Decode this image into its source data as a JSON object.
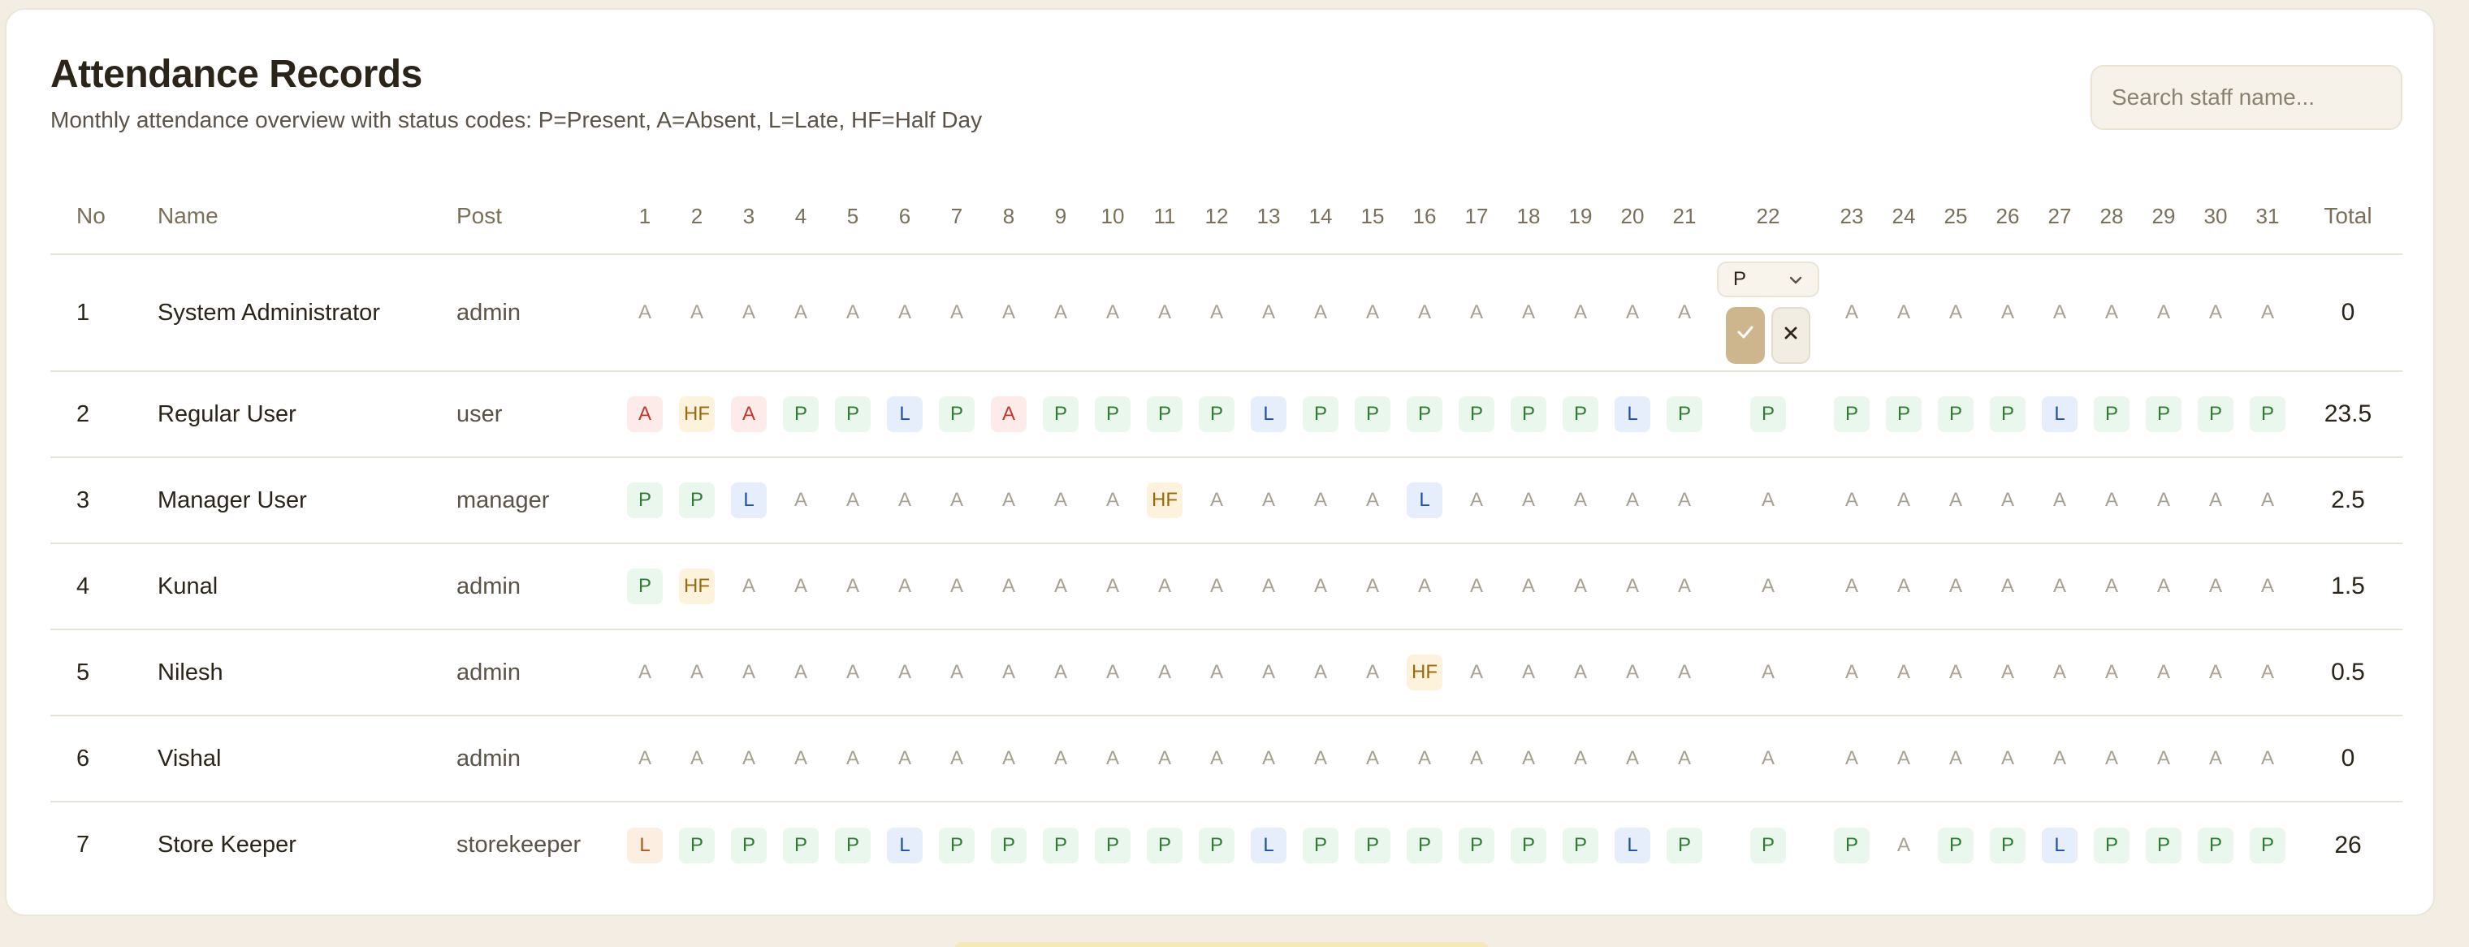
{
  "page": {
    "title": "Attendance Records",
    "subtitle": "Monthly attendance overview with status codes: P=Present, A=Absent, L=Late, HF=Half Day",
    "search_placeholder": "Search staff name..."
  },
  "table": {
    "headers": {
      "no": "No",
      "name": "Name",
      "post": "Post",
      "total": "Total"
    },
    "days": [
      "1",
      "2",
      "3",
      "4",
      "5",
      "6",
      "7",
      "8",
      "9",
      "10",
      "11",
      "12",
      "13",
      "14",
      "15",
      "16",
      "17",
      "18",
      "19",
      "20",
      "21",
      "22",
      "23",
      "24",
      "25",
      "26",
      "27",
      "28",
      "29",
      "30",
      "31"
    ],
    "rows": [
      {
        "no": "1",
        "name": "System Administrator",
        "post": "admin",
        "total": "0",
        "days": [
          "A",
          "A",
          "A",
          "A",
          "A",
          "A",
          "A",
          "A",
          "A",
          "A",
          "A",
          "A",
          "A",
          "A",
          "A",
          "A",
          "A",
          "A",
          "A",
          "A",
          "A",
          "",
          "A",
          "A",
          "A",
          "A",
          "A",
          "A",
          "A",
          "A",
          "A"
        ]
      },
      {
        "no": "2",
        "name": "Regular User",
        "post": "user",
        "total": "23.5",
        "days": [
          "A",
          "HF",
          "A",
          "P",
          "P",
          "L",
          "P",
          "A",
          "P",
          "P",
          "P",
          "P",
          "L",
          "P",
          "P",
          "P",
          "P",
          "P",
          "P",
          "L",
          "P",
          "P",
          "P",
          "P",
          "P",
          "P",
          "L",
          "P",
          "P",
          "P",
          "P"
        ]
      },
      {
        "no": "3",
        "name": "Manager User",
        "post": "manager",
        "total": "2.5",
        "days": [
          "P",
          "P",
          "L",
          "A",
          "A",
          "A",
          "A",
          "A",
          "A",
          "A",
          "HF",
          "A",
          "A",
          "A",
          "A",
          "L",
          "A",
          "A",
          "A",
          "A",
          "A",
          "A",
          "A",
          "A",
          "A",
          "A",
          "A",
          "A",
          "A",
          "A",
          "A"
        ]
      },
      {
        "no": "4",
        "name": "Kunal",
        "post": "admin",
        "total": "1.5",
        "days": [
          "P",
          "HF",
          "A",
          "A",
          "A",
          "A",
          "A",
          "A",
          "A",
          "A",
          "A",
          "A",
          "A",
          "A",
          "A",
          "A",
          "A",
          "A",
          "A",
          "A",
          "A",
          "A",
          "A",
          "A",
          "A",
          "A",
          "A",
          "A",
          "A",
          "A",
          "A"
        ]
      },
      {
        "no": "5",
        "name": "Nilesh",
        "post": "admin",
        "total": "0.5",
        "days": [
          "A",
          "A",
          "A",
          "A",
          "A",
          "A",
          "A",
          "A",
          "A",
          "A",
          "A",
          "A",
          "A",
          "A",
          "A",
          "HF",
          "A",
          "A",
          "A",
          "A",
          "A",
          "A",
          "A",
          "A",
          "A",
          "A",
          "A",
          "A",
          "A",
          "A",
          "A"
        ]
      },
      {
        "no": "6",
        "name": "Vishal",
        "post": "admin",
        "total": "0",
        "days": [
          "A",
          "A",
          "A",
          "A",
          "A",
          "A",
          "A",
          "A",
          "A",
          "A",
          "A",
          "A",
          "A",
          "A",
          "A",
          "A",
          "A",
          "A",
          "A",
          "A",
          "A",
          "A",
          "A",
          "A",
          "A",
          "A",
          "A",
          "A",
          "A",
          "A",
          "A"
        ]
      },
      {
        "no": "7",
        "name": "Store Keeper",
        "post": "storekeeper",
        "total": "26",
        "days": [
          "L",
          "P",
          "P",
          "P",
          "P",
          "L",
          "P",
          "P",
          "P",
          "P",
          "P",
          "P",
          "L",
          "P",
          "P",
          "P",
          "P",
          "P",
          "P",
          "L",
          "P",
          "P",
          "P",
          "A",
          "P",
          "P",
          "L",
          "P",
          "P",
          "P",
          "P"
        ]
      }
    ],
    "highlighted_absent": [
      [
        1,
        0
      ],
      [
        1,
        2
      ],
      [
        1,
        7
      ]
    ],
    "late_orange": [
      [
        6,
        0
      ]
    ]
  },
  "editor": {
    "row": 0,
    "day": "22",
    "selected_value": "P",
    "dropdown_icon": "chevron-down-icon",
    "save_icon": "check-icon",
    "cancel_icon": "close-icon"
  },
  "colors": {
    "present": "#2e7d32",
    "absent": "#a8a090",
    "absent_marked": "#c0392b",
    "late": "#1e4fb0",
    "half_day": "#9a6a0f",
    "accent_button": "#cdb68e"
  }
}
